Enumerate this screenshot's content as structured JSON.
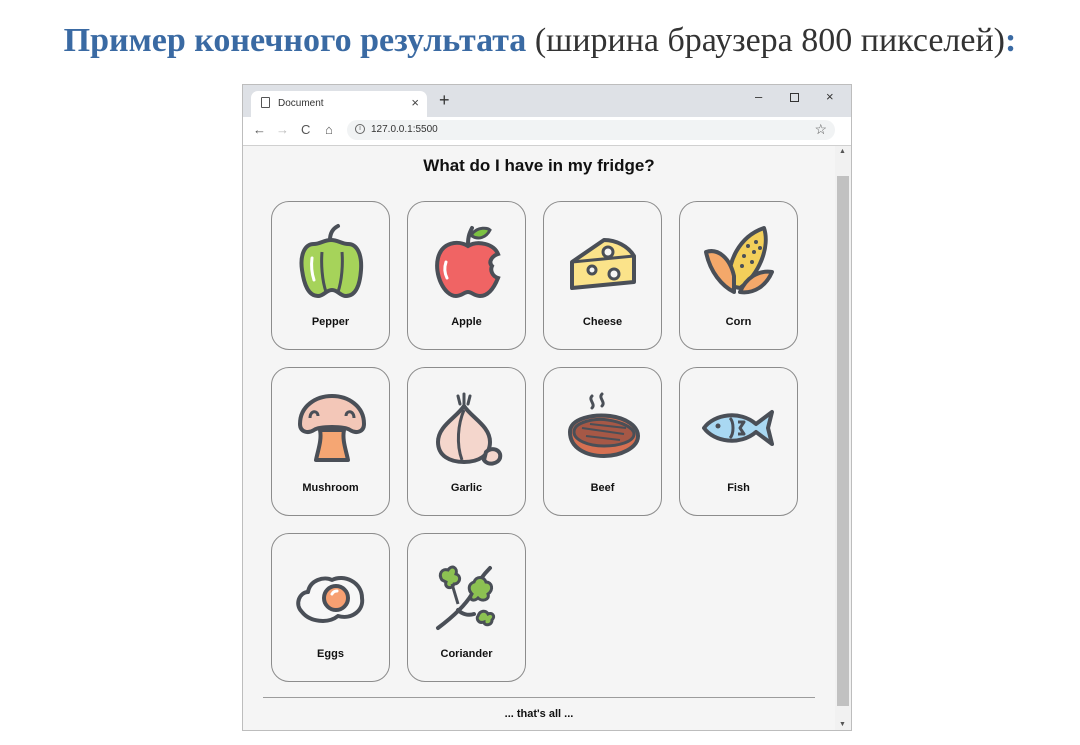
{
  "heading": {
    "highlight": "Пример конечного результата",
    "rest": " (ширина браузера 800 пикселей)",
    "colon": ":"
  },
  "browser": {
    "tab_title": "Document",
    "tab_close": "×",
    "new_tab": "+",
    "win_min": "–",
    "win_close": "×",
    "nav_back": "←",
    "nav_forward": "→",
    "nav_reload": "C",
    "nav_home": "⌂",
    "info": "i",
    "url": "127.0.0.1:5500",
    "star": "☆"
  },
  "page": {
    "title": "What do I have in my fridge?",
    "items": [
      {
        "label": "Pepper",
        "icon": "pepper-icon"
      },
      {
        "label": "Apple",
        "icon": "apple-icon"
      },
      {
        "label": "Cheese",
        "icon": "cheese-icon"
      },
      {
        "label": "Corn",
        "icon": "corn-icon"
      },
      {
        "label": "Mushroom",
        "icon": "mushroom-icon"
      },
      {
        "label": "Garlic",
        "icon": "garlic-icon"
      },
      {
        "label": "Beef",
        "icon": "beef-icon"
      },
      {
        "label": "Fish",
        "icon": "fish-icon"
      },
      {
        "label": "Eggs",
        "icon": "eggs-icon"
      },
      {
        "label": "Coriander",
        "icon": "coriander-icon"
      }
    ],
    "footer": "... that's all ..."
  },
  "scrollbar": {
    "up": "▲",
    "down": "▼"
  }
}
